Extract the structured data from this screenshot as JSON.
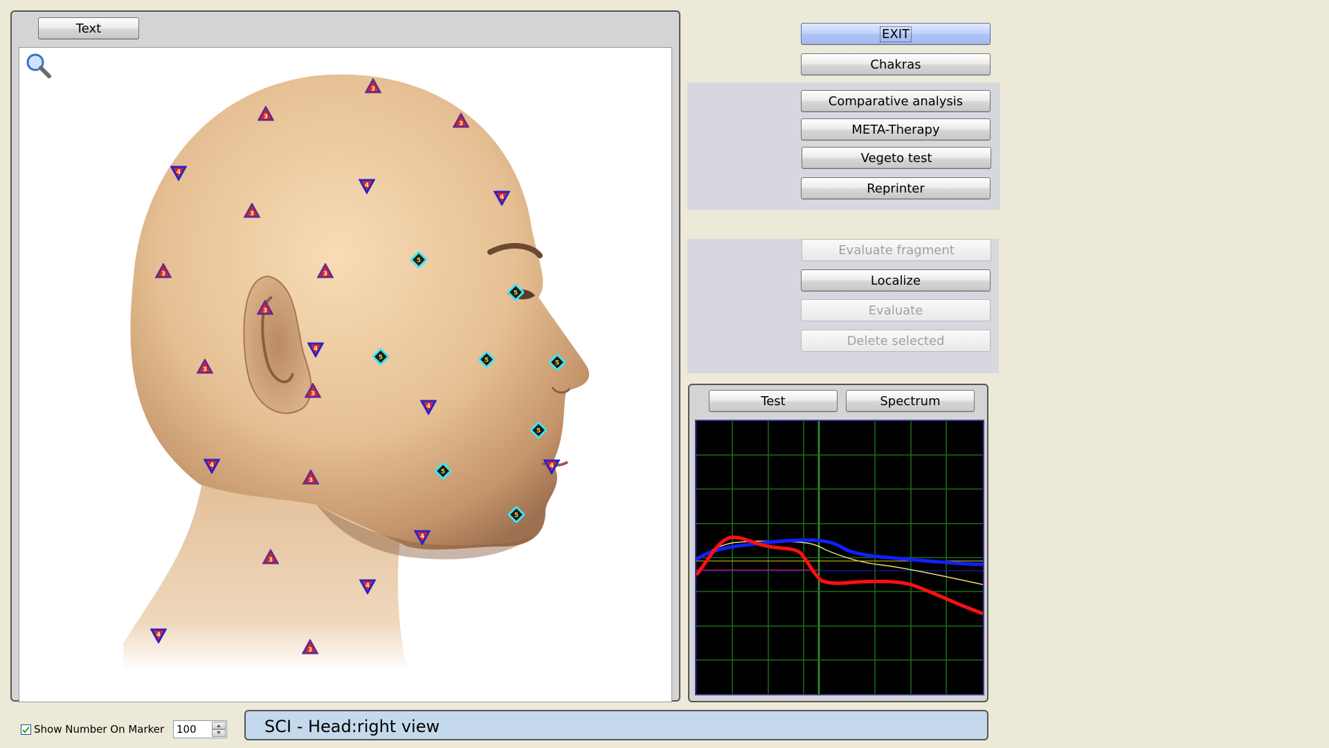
{
  "viewer": {
    "text_button": "Text",
    "show_number_label": "Show Number On Marker",
    "show_number_checked": true,
    "zoom_value": "100"
  },
  "status": {
    "title": "SCI - Head:right view"
  },
  "actions": {
    "exit": "EXIT",
    "chakras": "Chakras",
    "comparative": "Comparative analysis",
    "meta": "META-Therapy",
    "vegeto": "Vegeto test",
    "reprinter": "Reprinter",
    "evaluate_fragment": "Evaluate fragment",
    "localize": "Localize",
    "evaluate": "Evaluate",
    "delete_selected": "Delete selected"
  },
  "spectrum_panel": {
    "test": "Test",
    "spectrum": "Spectrum"
  },
  "marker_levels": {
    "triangle": "3",
    "inverted": "4",
    "diamond": "5"
  },
  "colors": {
    "red_line": "#ff1010",
    "blue_line": "#1020ff",
    "yellow_line": "#e8e070",
    "grid": "#1a6e1a"
  }
}
